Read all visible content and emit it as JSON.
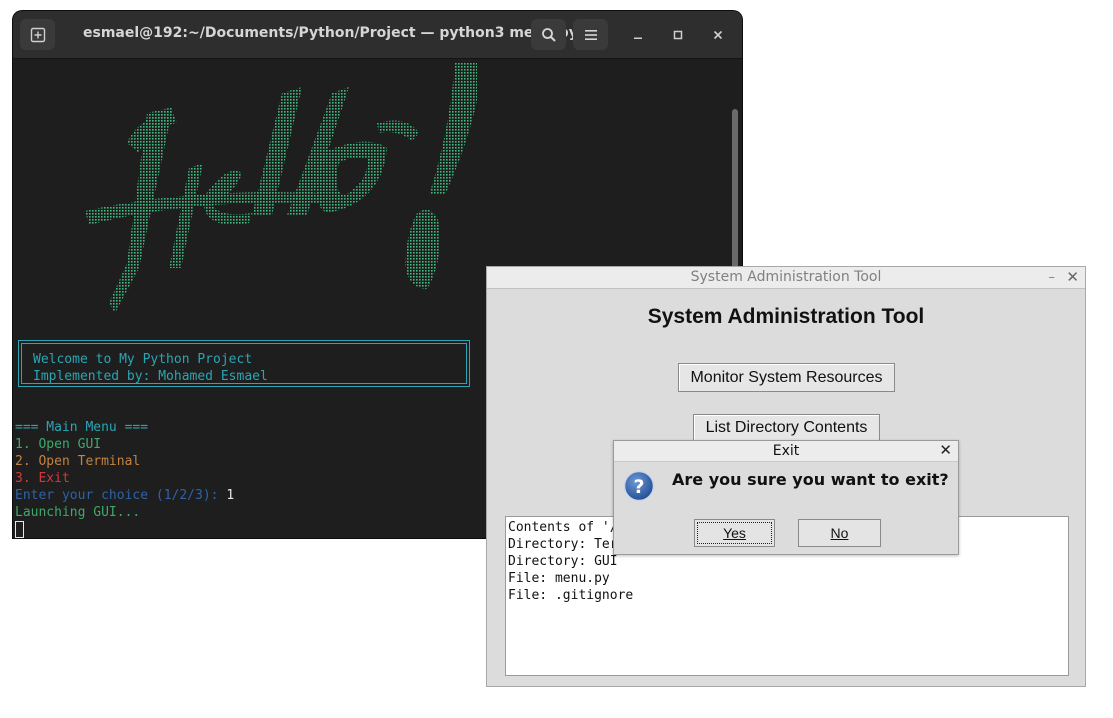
{
  "terminal": {
    "title": "esmael@192:~/Documents/Python/Project — python3 menu.py",
    "icons": {
      "new_tab": "new-tab-icon",
      "search": "search-icon",
      "menu": "hamburger-icon",
      "minimize": "minimize-icon",
      "maximize": "maximize-icon",
      "close": "close-icon"
    },
    "ascii_art_word": "Hello!",
    "welcome": {
      "line1": "Welcome to My Python Project",
      "line2": "Implemented by: Mohamed Esmael"
    },
    "menu": {
      "header": "=== Main Menu ===",
      "opt1": "1. Open GUI",
      "opt2": "2. Open Terminal",
      "opt3": "3. Exit",
      "prompt": "Enter your choice (1/2/3): ",
      "input": "1",
      "status": "Launching GUI..."
    }
  },
  "admin_tool": {
    "window_title": "System Administration Tool",
    "heading": "System Administration Tool",
    "btn_monitor": "Monitor System Resources",
    "btn_list": "List Directory Contents",
    "output": {
      "line1": "Contents of '/",
      "line2": "Directory: Ter",
      "line3": "Directory: GUI",
      "line4": "File: menu.py",
      "line5": "File: .gitignore"
    }
  },
  "exit_dialog": {
    "title": "Exit",
    "message": "Are you sure you want to exit?",
    "yes": "Yes",
    "no": "No",
    "icon": "question-icon"
  },
  "colors": {
    "terminal_bg": "#1e1e1e",
    "ascii_green": "#3dba7f",
    "cyan": "#2aa5b4",
    "menu_green": "#3fa86a",
    "menu_orange": "#c3833e",
    "menu_red": "#d23a3a",
    "prompt_blue": "#2e63a8"
  }
}
